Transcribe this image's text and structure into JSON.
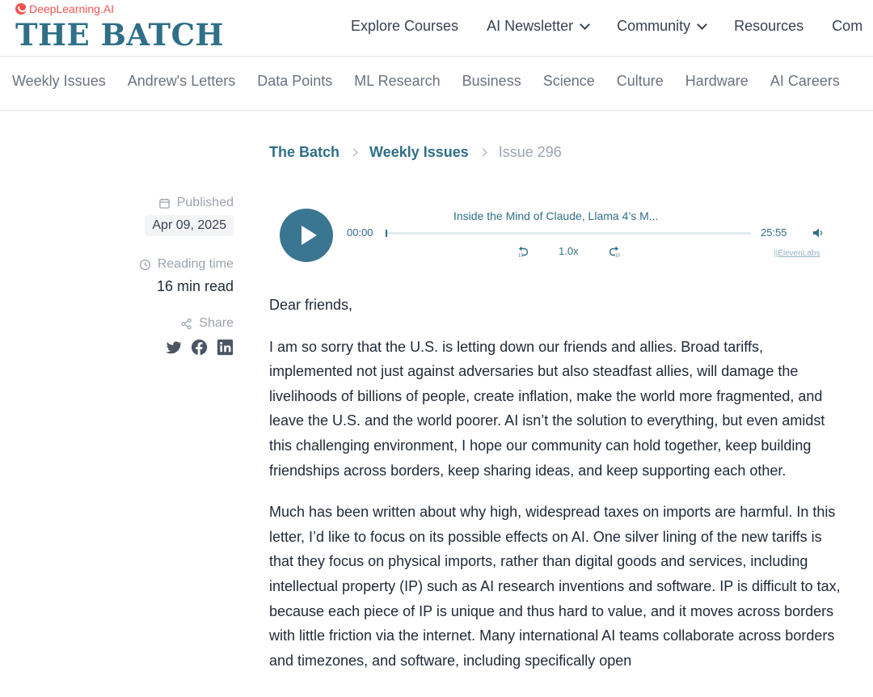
{
  "header": {
    "dl_logo_text": "DeepLearning.AI",
    "site_title": "THE BATCH",
    "nav": [
      {
        "label": "Explore Courses",
        "has_dropdown": false
      },
      {
        "label": "AI Newsletter",
        "has_dropdown": true
      },
      {
        "label": "Community",
        "has_dropdown": true
      },
      {
        "label": "Resources",
        "has_dropdown": false
      },
      {
        "label": "Com",
        "has_dropdown": false
      }
    ]
  },
  "categories": [
    "Weekly Issues",
    "Andrew's Letters",
    "Data Points",
    "ML Research",
    "Business",
    "Science",
    "Culture",
    "Hardware",
    "AI Careers"
  ],
  "breadcrumb": {
    "root": "The Batch",
    "section": "Weekly Issues",
    "current": "Issue 296"
  },
  "meta": {
    "published_label": "Published",
    "published_date": "Apr 09, 2025",
    "reading_label": "Reading time",
    "reading_value": "16 min read",
    "share_label": "Share",
    "share_icons": [
      "twitter-icon",
      "facebook-icon",
      "linkedin-icon"
    ]
  },
  "player": {
    "title": "Inside the Mind of Claude, Llama 4’s M...",
    "current_time": "00:00",
    "total_time": "25:55",
    "progress": 0,
    "speed": "1.0x",
    "brand": "||ElevenLabs"
  },
  "article": {
    "greeting": "Dear friends,",
    "paragraphs": [
      "I am so sorry that the U.S. is letting down our friends and allies. Broad tariffs, implemented not just against adversaries but also steadfast allies, will damage the livelihoods of billions of people, create inflation, make the world more fragmented, and leave the U.S. and the world poorer. AI isn’t the solution to everything, but even amidst this challenging environment, I hope our community can hold together, keep building friendships across borders, keep sharing ideas, and keep supporting each other.",
      "Much has been written about why high, widespread taxes on imports are harmful. In this letter, I’d like to focus on its possible effects on AI. One silver lining of the new tariffs is that they focus on physical imports, rather than digital goods and services, including intellectual property (IP) such as AI research inventions and software. IP is difficult to tax, because each piece of IP is unique and thus hard to value, and it moves across borders with little friction via the internet. Many international AI teams collaborate across borders and timezones, and software, including specifically open"
    ]
  },
  "colors": {
    "brand_teal": "#2f6f87",
    "play_button": "#3a7591",
    "dl_red": "#f0544f"
  }
}
